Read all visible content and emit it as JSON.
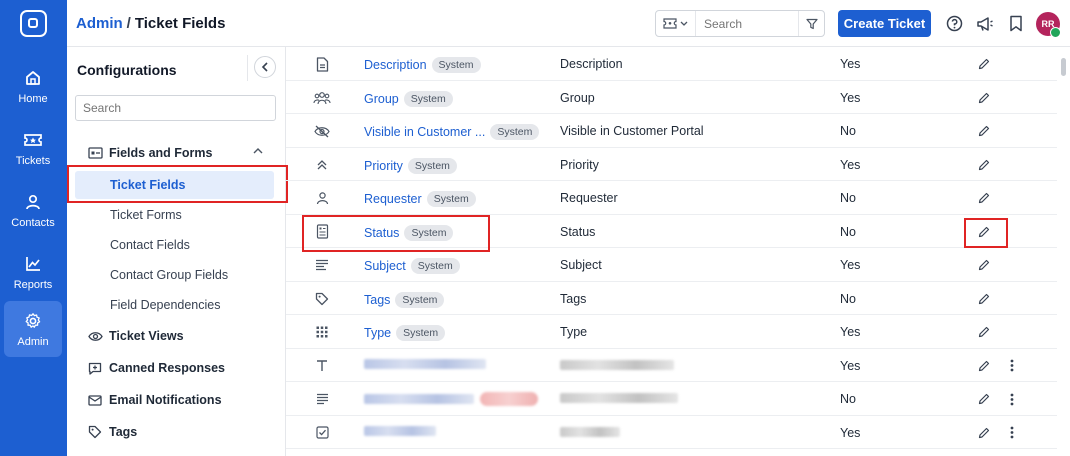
{
  "rail": {
    "items": [
      {
        "label": "Home",
        "icon": "home-icon"
      },
      {
        "label": "Tickets",
        "icon": "ticket-icon"
      },
      {
        "label": "Contacts",
        "icon": "user-icon"
      },
      {
        "label": "Reports",
        "icon": "chart-icon"
      },
      {
        "label": "Admin",
        "icon": "gear-icon",
        "active": true
      }
    ]
  },
  "header": {
    "breadcrumb_root": "Admin",
    "breadcrumb_separator": "/",
    "breadcrumb_current": "Ticket Fields",
    "search_placeholder": "Search",
    "create_button": "Create Ticket",
    "avatar_initials": "RR"
  },
  "config": {
    "title": "Configurations",
    "search_placeholder": "Search",
    "groups": {
      "fields_and_forms": "Fields and Forms",
      "ticket_views": "Ticket Views",
      "canned_responses": "Canned Responses",
      "email_notifications": "Email Notifications",
      "tags": "Tags"
    },
    "sub_items": [
      "Ticket Fields",
      "Ticket Forms",
      "Contact Fields",
      "Contact Group Fields",
      "Field Dependencies"
    ]
  },
  "fields": {
    "badge": "System",
    "rows": [
      {
        "name": "Description",
        "label": "Description",
        "required": "Yes",
        "icon": "document-icon"
      },
      {
        "name": "Group",
        "label": "Group",
        "required": "Yes",
        "icon": "group-icon"
      },
      {
        "name": "Visible in Customer ...",
        "label": "Visible in Customer Portal",
        "required": "No",
        "icon": "eye-off-icon"
      },
      {
        "name": "Priority",
        "label": "Priority",
        "required": "Yes",
        "icon": "priority-icon"
      },
      {
        "name": "Requester",
        "label": "Requester",
        "required": "No",
        "icon": "user-icon"
      },
      {
        "name": "Status",
        "label": "Status",
        "required": "No",
        "icon": "status-icon"
      },
      {
        "name": "Subject",
        "label": "Subject",
        "required": "Yes",
        "icon": "subject-icon"
      },
      {
        "name": "Tags",
        "label": "Tags",
        "required": "No",
        "icon": "tag-icon"
      },
      {
        "name": "Type",
        "label": "Type",
        "required": "Yes",
        "icon": "grid-icon"
      }
    ],
    "custom_rows": [
      {
        "required": "Yes",
        "icon": "text-icon"
      },
      {
        "required": "No",
        "icon": "paragraph-icon"
      },
      {
        "required": "Yes",
        "icon": "checkbox-icon"
      }
    ]
  },
  "colors": {
    "brand": "#1d5fd1",
    "highlight": "#e02424",
    "avatar": "#b4245c",
    "online": "#22a55a"
  }
}
